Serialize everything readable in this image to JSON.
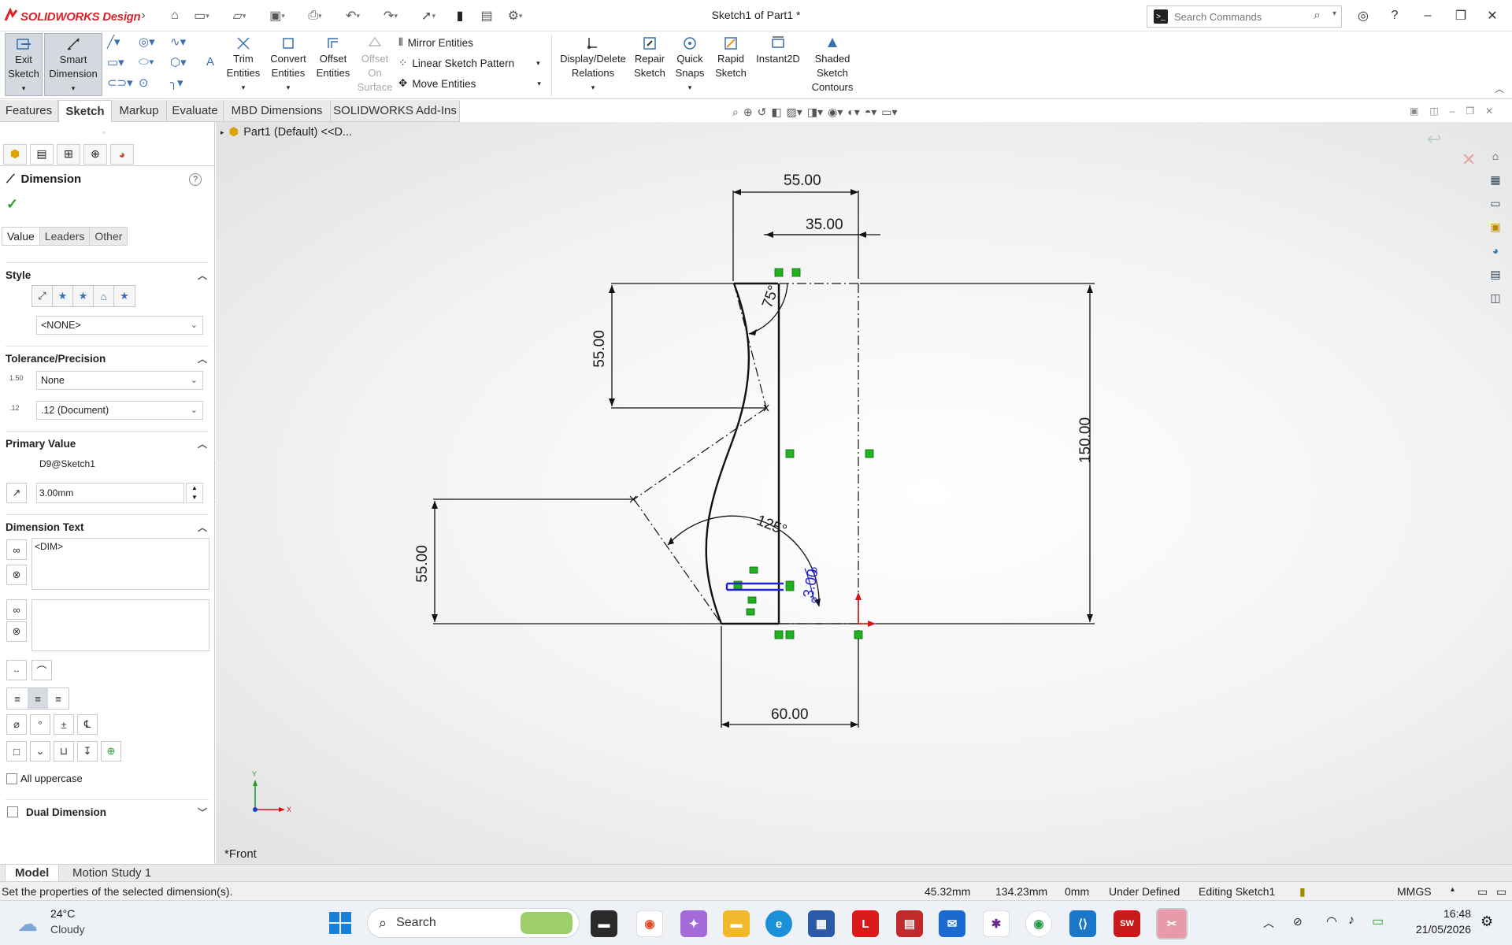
{
  "app": {
    "brand": "SOLIDWORKS Design",
    "doc_title": "Sketch1 of Part1 *"
  },
  "search": {
    "placeholder": "Search Commands"
  },
  "ribbon": {
    "exit_sketch": "Exit\nSketch",
    "smart_dimension": "Smart\nDimension",
    "trim": "Trim\nEntities",
    "convert": "Convert\nEntities",
    "offset": "Offset\nEntities",
    "offset_surface": "Offset\nOn\nSurface",
    "mirror": "Mirror Entities",
    "linear_pattern": "Linear Sketch Pattern",
    "move": "Move Entities",
    "display_delete": "Display/Delete\nRelations",
    "repair": "Repair\nSketch",
    "quick_snaps": "Quick\nSnaps",
    "rapid": "Rapid\nSketch",
    "instant2d": "Instant2D",
    "shaded": "Shaded\nSketch\nContours"
  },
  "tabs": [
    "Features",
    "Sketch",
    "Markup",
    "Evaluate",
    "MBD Dimensions",
    "SOLIDWORKS Add-Ins"
  ],
  "pm": {
    "title": "Dimension",
    "subtabs": [
      "Value",
      "Leaders",
      "Other"
    ],
    "style_label": "Style",
    "style_value": "<NONE>",
    "tol_label": "Tolerance/Precision",
    "tol_value": "None",
    "precision_value": ".12 (Document)",
    "primary_label": "Primary Value",
    "primary_name": "D9@Sketch1",
    "primary_value": "3.00mm",
    "dimtext_label": "Dimension Text",
    "dimtext_value": "<DIM>",
    "uppercase_label": "All uppercase",
    "dual_label": "Dual Dimension"
  },
  "tree": {
    "root": "Part1 (Default) <<D..."
  },
  "view": {
    "label": "*Front"
  },
  "dims": {
    "d1": "55.00",
    "d2": "35.00",
    "d3": "55.00",
    "d4": "150.00",
    "d5": "55.00",
    "d6": "60.00",
    "a1": "75°",
    "a2": "125°",
    "sel": "3.00"
  },
  "bottom_tabs": [
    "Model",
    "Motion Study 1"
  ],
  "status": {
    "message": "Set the properties of the selected dimension(s).",
    "x": "45.32mm",
    "y": "134.23mm",
    "z": "0mm",
    "defined": "Under Defined",
    "editing": "Editing Sketch1",
    "units": "MMGS"
  },
  "taskbar": {
    "temp": "24°C",
    "weather": "Cloudy",
    "search": "Search",
    "time": "16:48",
    "date": "21/05/2026"
  },
  "colors": {
    "accent": "#d8232a",
    "sketch_green": "#21b021",
    "selected_blue": "#2323d0"
  }
}
